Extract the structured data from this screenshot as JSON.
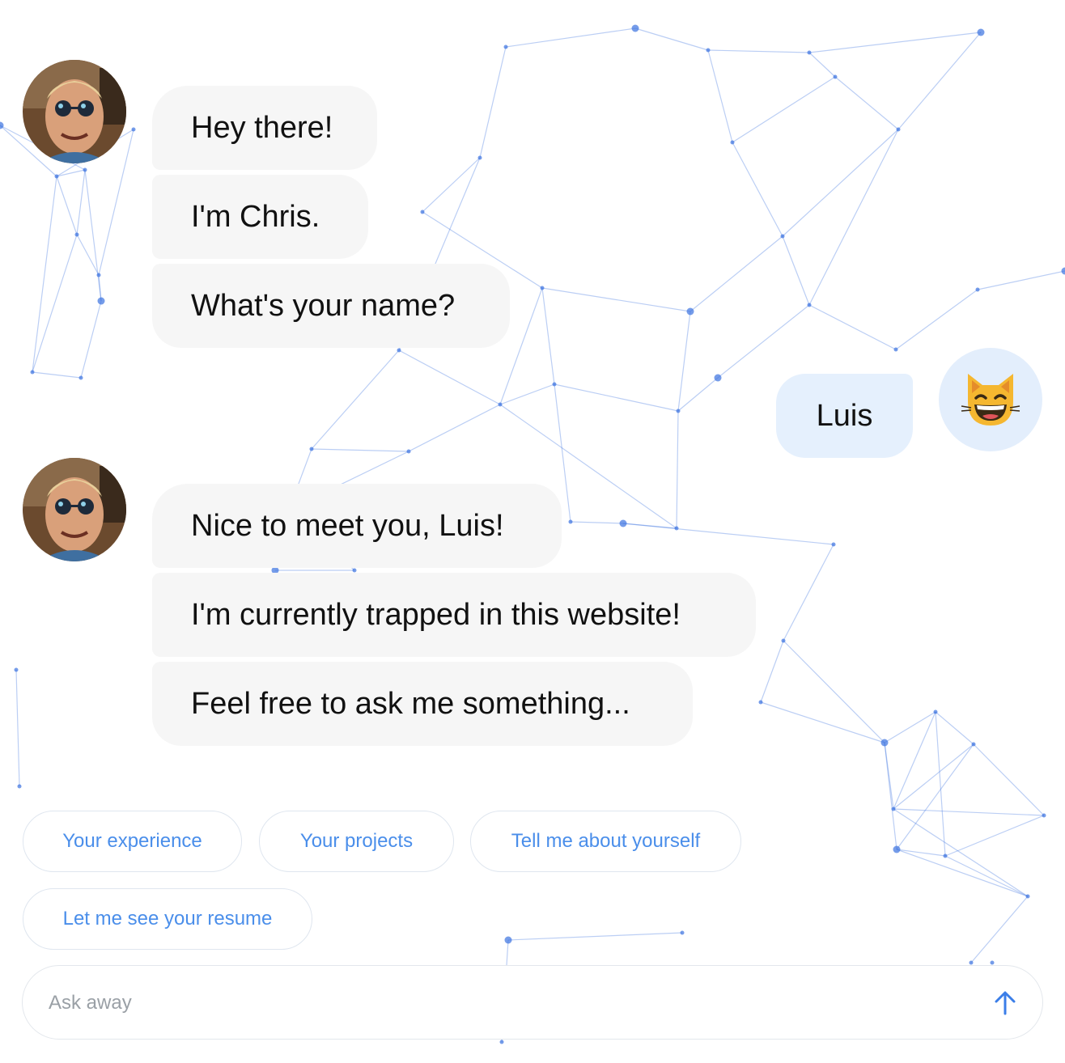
{
  "colors": {
    "accent": "#4a8eea",
    "bot_bubble": "#f6f6f6",
    "user_bubble": "#e5f0fd",
    "network_line": "#3b72e0"
  },
  "conversation": {
    "bot_group_1": {
      "avatar_icon": "profile-photo",
      "messages": [
        "Hey there!",
        "I'm Chris.",
        "What's your name?"
      ]
    },
    "user_message": {
      "text": "Luis",
      "avatar_icon": "grinning-cat-emoji",
      "avatar_glyph": "😸"
    },
    "bot_group_2": {
      "avatar_icon": "profile-photo",
      "messages": [
        "Nice to meet you, Luis!",
        "I'm currently trapped in this website!",
        "Feel free to ask me something..."
      ]
    }
  },
  "suggestions": [
    "Your experience",
    "Your projects",
    "Tell me about yourself",
    "Let me see your resume"
  ],
  "composer": {
    "placeholder": "Ask away",
    "send_icon": "arrow-up-icon"
  }
}
